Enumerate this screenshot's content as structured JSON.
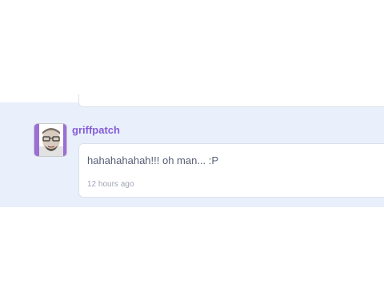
{
  "comment": {
    "username": "griffpatch",
    "text": "hahahahahah!!! oh man... :P",
    "timestamp": "12 hours ago",
    "avatar_icon": "user-avatar-icon"
  },
  "colors": {
    "highlight_band": "#e9f0fc",
    "username": "#855cd6",
    "text": "#575e75",
    "timestamp": "#a0a5b5",
    "bubble_border": "#dce1ea"
  }
}
